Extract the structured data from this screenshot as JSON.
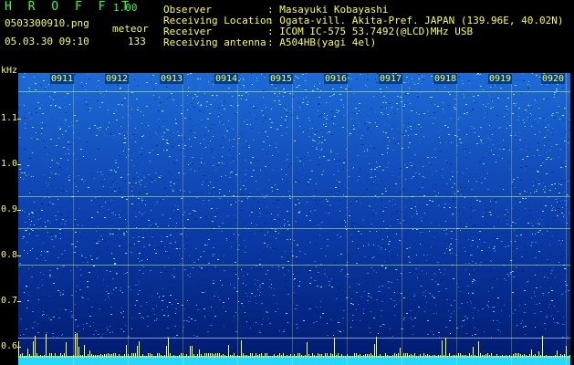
{
  "app": {
    "name": "H R O F F T",
    "version": "1.00",
    "filename": "0503300910.png",
    "mode": "meteor",
    "datetime": "05.03.30 09:10",
    "count": "133"
  },
  "info": [
    {
      "label": "Observer",
      "value": ": Masayuki Kobayashi"
    },
    {
      "label": "Receiving Location",
      "value": ": Ogata-vill. Akita-Pref. JAPAN (139.96E, 40.02N)"
    },
    {
      "label": "Receiver",
      "value": ": ICOM IC-575 53.7492(@LCD)MHz USB"
    },
    {
      "label": "Receiving antenna",
      "value": ": A504HB(yagi 4el)"
    }
  ],
  "axis": {
    "unit": "kHz",
    "yticks": [
      "1.1",
      "1.0",
      "0.9",
      "0.8",
      "0.7",
      "0.6"
    ],
    "times": [
      "0911",
      "0912",
      "0913",
      "0914",
      "0915",
      "0916",
      "0917",
      "0918",
      "0919",
      "0920"
    ]
  },
  "colors": {
    "header_green": "#37ff37",
    "header_yellow": "#ffff3a",
    "background": "#000000",
    "spectrum_low": "#001a6e",
    "spectrum_mid": "#1d6bd8",
    "spectrum_high": "#8ff2ff"
  }
}
